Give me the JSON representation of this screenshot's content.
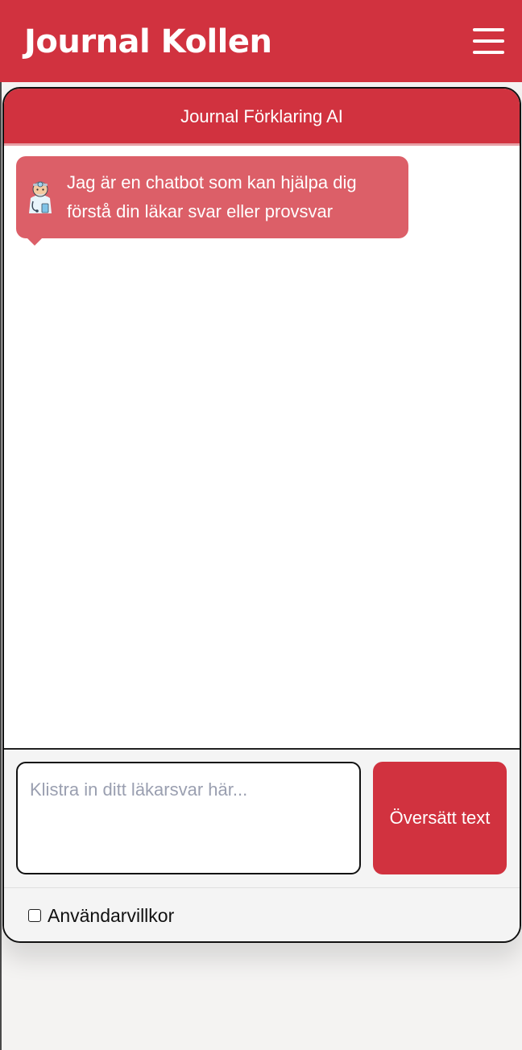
{
  "header": {
    "brand": "Journal Kollen",
    "menu_icon": "hamburger-menu-icon"
  },
  "chat": {
    "title": "Journal Förklaring AI",
    "bot_avatar_icon": "doctor-avatar-icon",
    "messages": [
      {
        "sender": "bot",
        "text": "Jag är en chatbot som kan hjälpa dig förstå din läkar svar eller provsvar"
      }
    ]
  },
  "composer": {
    "placeholder": "Klistra in ditt läkarsvar här...",
    "value": "",
    "submit_label": "Översätt text"
  },
  "terms": {
    "label": "Användarvillkor",
    "checked": false
  },
  "colors": {
    "brand_red": "#d1323f",
    "bubble_red": "#dc5f68",
    "placeholder_gray": "#9a9fb0"
  }
}
